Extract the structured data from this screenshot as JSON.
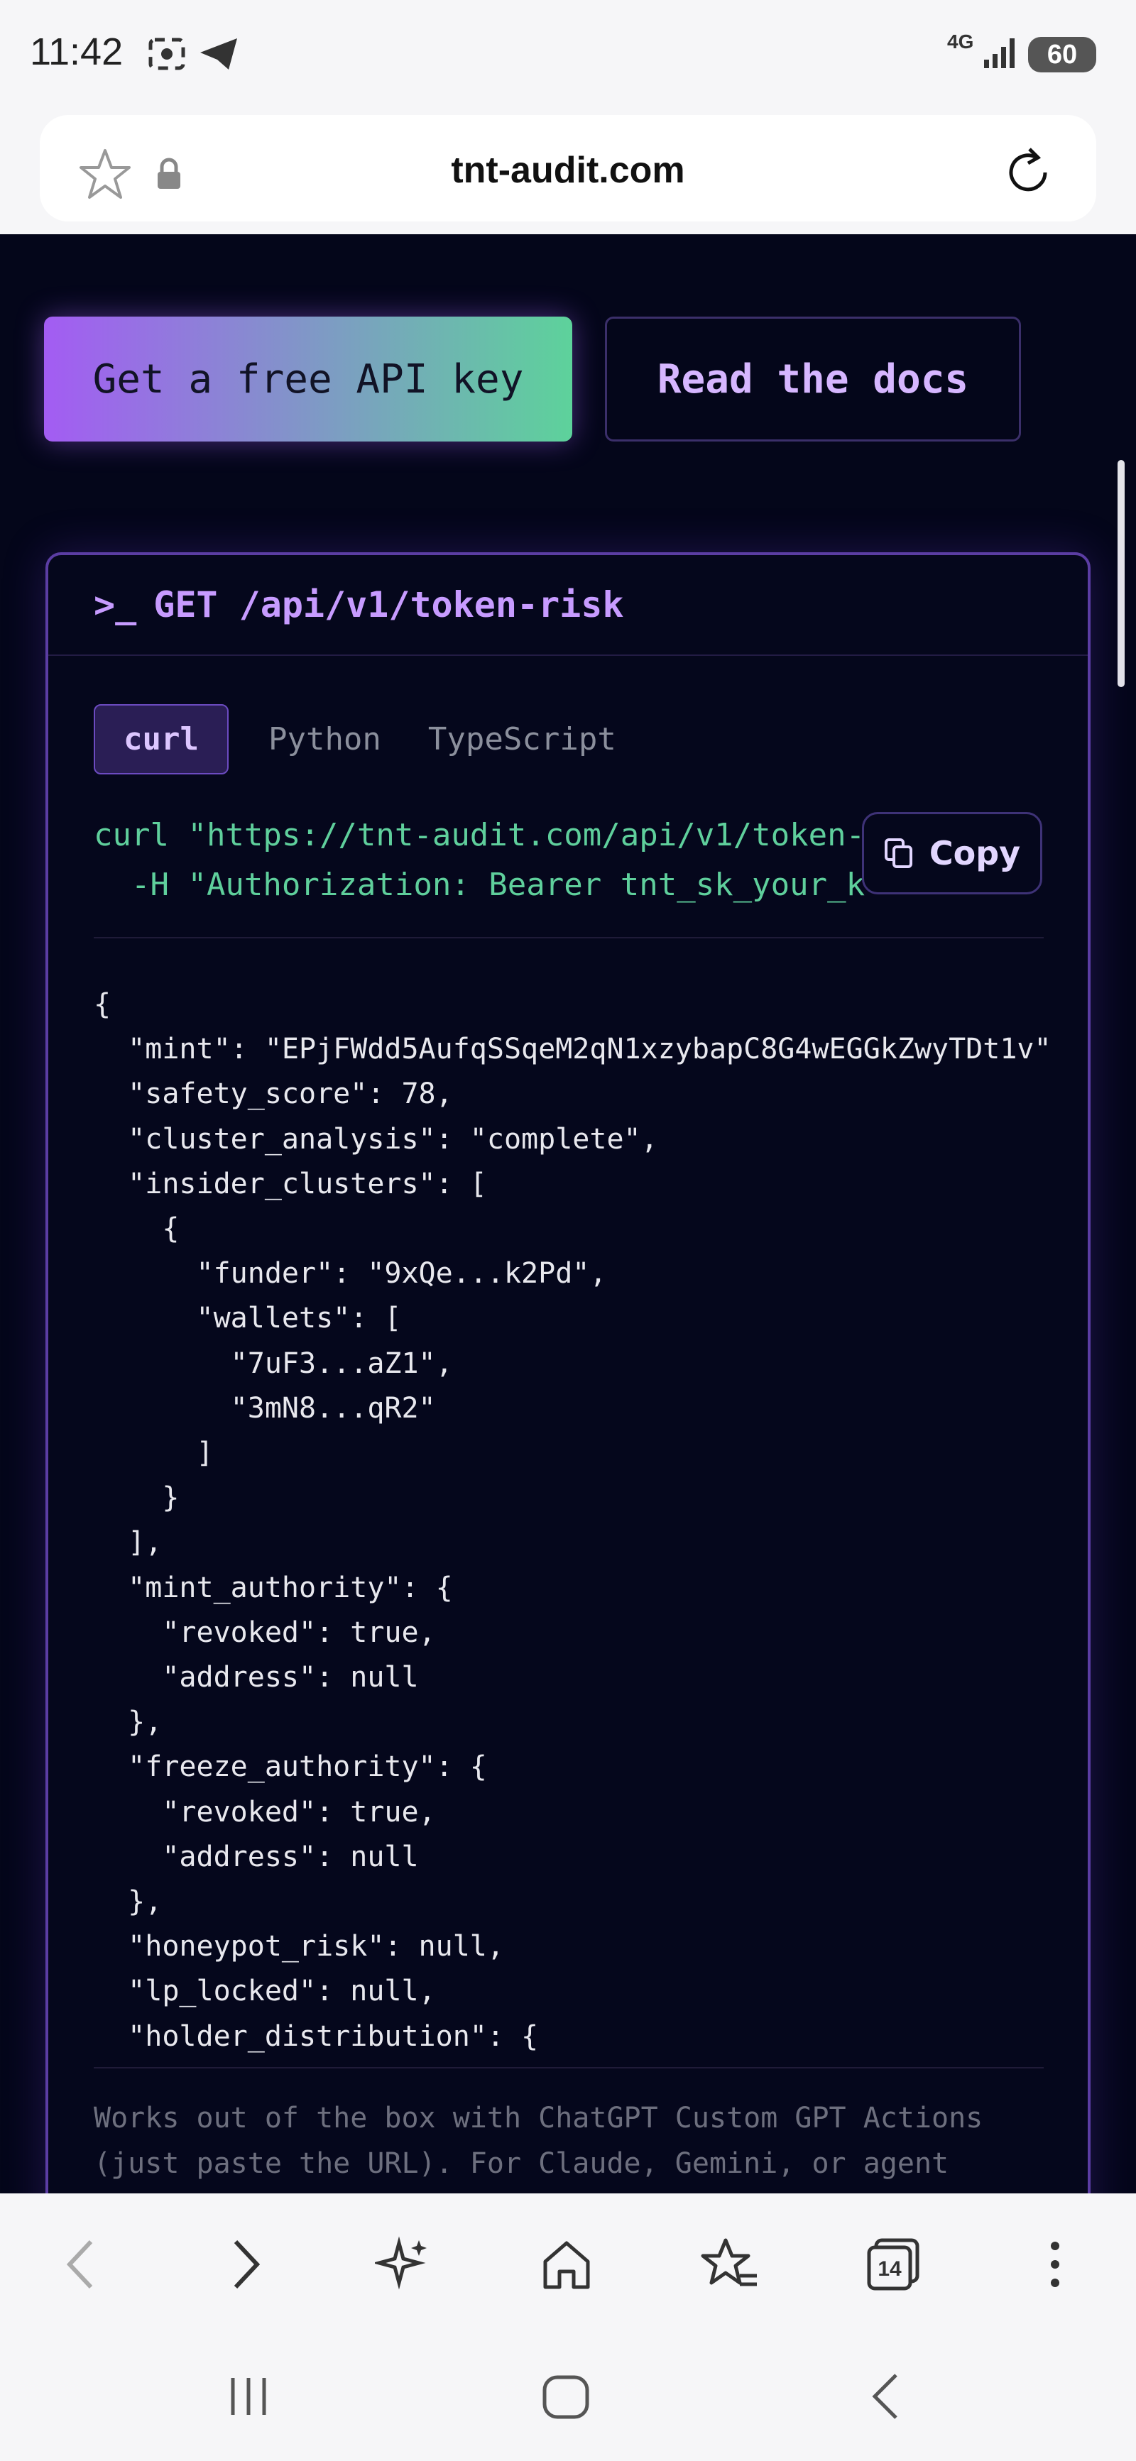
{
  "status_bar": {
    "time": "11:42",
    "network": "4G",
    "battery": "60"
  },
  "browser": {
    "url": "tnt-audit.com",
    "tab_count": "14"
  },
  "hero": {
    "primary_button": "Get a free API key",
    "secondary_button": "Read the docs"
  },
  "api_card": {
    "prompt": ">_",
    "endpoint": "GET /api/v1/token-risk",
    "tabs": [
      "curl",
      "Python",
      "TypeScript"
    ],
    "active_tab": "curl",
    "command_line1": "curl \"https://tnt-audit.com/api/v1/token-",
    "command_line2": "  -H \"Authorization: Bearer tnt_sk_your_k",
    "copy_label": "Copy",
    "response_lines": [
      "{",
      "  \"mint\": \"EPjFWdd5AufqSSqeM2qN1xzybapC8G4wEGGkZwyTDt1v\",",
      "  \"safety_score\": 78,",
      "  \"cluster_analysis\": \"complete\",",
      "  \"insider_clusters\": [",
      "    {",
      "      \"funder\": \"9xQe...k2Pd\",",
      "      \"wallets\": [",
      "        \"7uF3...aZ1\",",
      "        \"3mN8...qR2\"",
      "      ]",
      "    }",
      "  ],",
      "  \"mint_authority\": {",
      "    \"revoked\": true,",
      "    \"address\": null",
      "  },",
      "  \"freeze_authority\": {",
      "    \"revoked\": true,",
      "    \"address\": null",
      "  },",
      "  \"honeypot_risk\": null,",
      "  \"lp_locked\": null,",
      "  \"holder_distribution\": {"
    ],
    "footer_line1": "Works out of the box with ChatGPT Custom GPT Actions",
    "footer_line2": "(just paste the URL). For Claude, Gemini, or agent"
  },
  "colors": {
    "accent_purple": "#a35cf3",
    "accent_green": "#5dd29b",
    "code_green": "#5fcf9c",
    "background": "#04061a"
  }
}
